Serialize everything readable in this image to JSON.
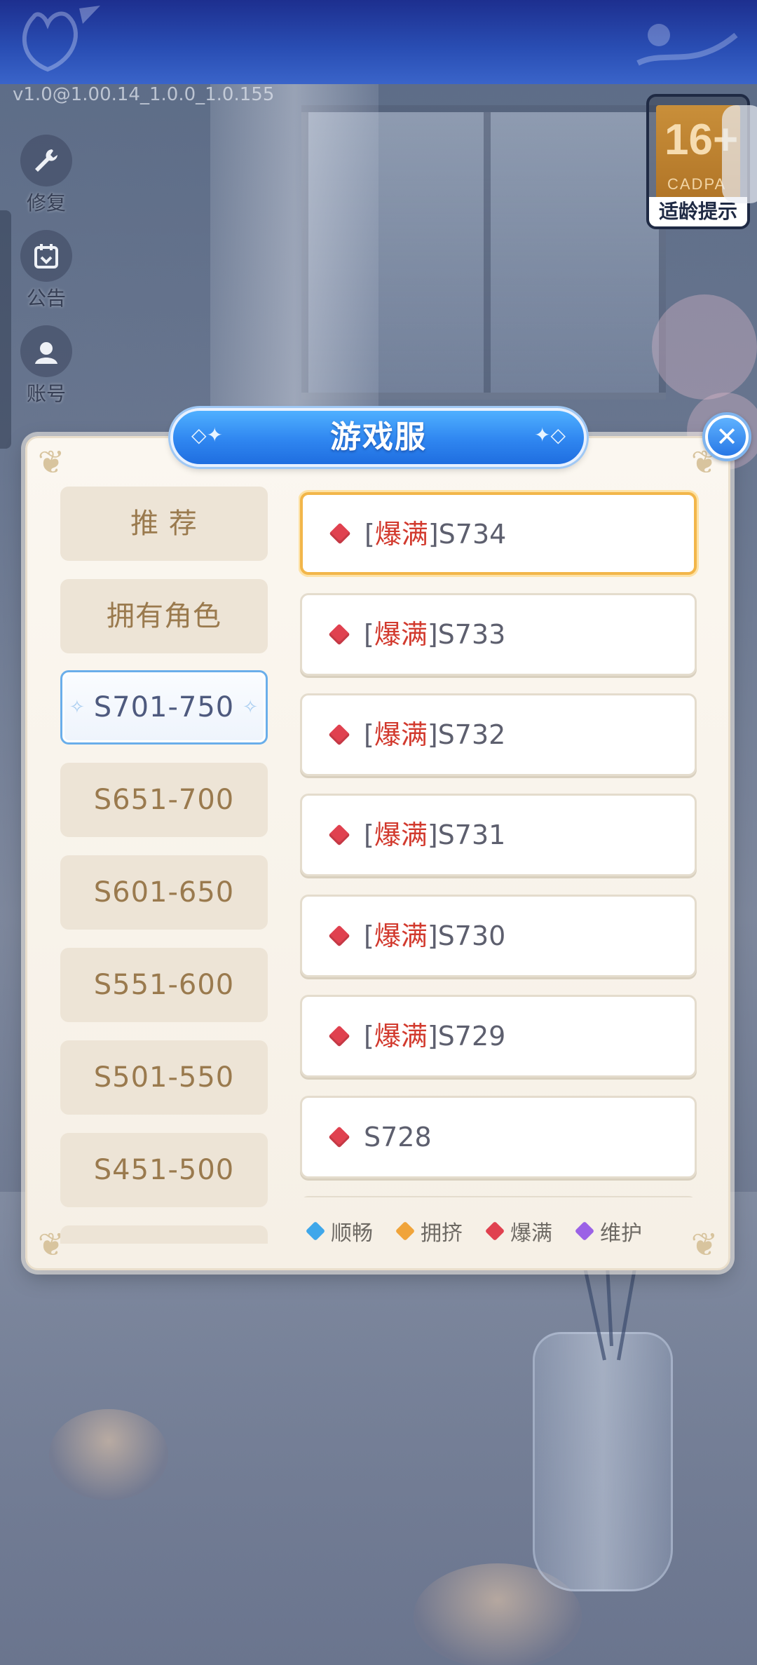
{
  "app": {
    "version": "v1.0@1.00.14_1.0.0_1.0.155"
  },
  "age_rating": {
    "number": "16+",
    "org": "CADPA",
    "label": "适龄提示"
  },
  "tools": [
    {
      "label": "修复",
      "icon": "wrench-icon"
    },
    {
      "label": "公告",
      "icon": "calendar-icon"
    },
    {
      "label": "账号",
      "icon": "avatar-icon"
    }
  ],
  "dialog": {
    "title": "游戏服",
    "close_icon": "close-icon"
  },
  "categories": [
    {
      "label": "推 荐",
      "selected": false
    },
    {
      "label": "拥有角色",
      "selected": false
    },
    {
      "label": "S701-750",
      "selected": true
    },
    {
      "label": "S651-700",
      "selected": false
    },
    {
      "label": "S601-650",
      "selected": false
    },
    {
      "label": "S551-600",
      "selected": false
    },
    {
      "label": "S501-550",
      "selected": false
    },
    {
      "label": "S451-500",
      "selected": false
    }
  ],
  "servers": [
    {
      "tag": "爆满",
      "name": "S734",
      "status_color": "#e0414f",
      "selected": true
    },
    {
      "tag": "爆满",
      "name": "S733",
      "status_color": "#e0414f",
      "selected": false
    },
    {
      "tag": "爆满",
      "name": "S732",
      "status_color": "#e0414f",
      "selected": false
    },
    {
      "tag": "爆满",
      "name": "S731",
      "status_color": "#e0414f",
      "selected": false
    },
    {
      "tag": "爆满",
      "name": "S730",
      "status_color": "#e0414f",
      "selected": false
    },
    {
      "tag": "爆满",
      "name": "S729",
      "status_color": "#e0414f",
      "selected": false
    },
    {
      "tag": "",
      "name": "S728",
      "status_color": "#e0414f",
      "selected": false
    }
  ],
  "legend": [
    {
      "label": "顺畅",
      "color": "#3fa7ea"
    },
    {
      "label": "拥挤",
      "color": "#f0a43a"
    },
    {
      "label": "爆满",
      "color": "#e0414f"
    },
    {
      "label": "维护",
      "color": "#9b62e6"
    }
  ]
}
